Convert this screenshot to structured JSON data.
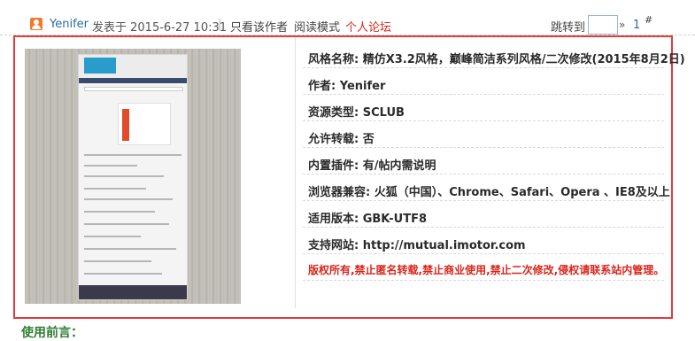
{
  "post_header": {
    "author": "Yenifer",
    "post_time": "发表于 2015-6-27 10:31",
    "separator": "|",
    "only_author": "只看该作者",
    "read_mode": "阅读模式",
    "personal_forum": "个人论坛",
    "jump_label": "跳转到",
    "jump_arrow": "»",
    "floor_number": "1",
    "floor_sign": "#"
  },
  "details": [
    {
      "label": "风格名称: 精仿X3.2风格，巅峰简洁系列风格/二次修改(2015年8月2日)"
    },
    {
      "label": "作者: Yenifer"
    },
    {
      "label": "资源类型: SCLUB"
    },
    {
      "label": "允许转载: 否"
    },
    {
      "label": "内置插件: 有/帖内需说明"
    },
    {
      "label": "浏览器兼容: 火狐（中国）、Chrome、Safari、Opera 、IE8及以上"
    },
    {
      "label": "适用版本: GBK-UTF8"
    },
    {
      "label": "支持网站: http://mutual.imotor.com"
    }
  ],
  "copyright_notice": "版权所有,禁止匿名转载,禁止商业使用,禁止二次修改,侵权请联系站内管理。",
  "usage_title": "使用前言：",
  "colors": {
    "link_blue": "#2b6ca3",
    "accent_red": "#d9261c",
    "frame_red": "#e23b3b",
    "heading_green": "#2f7d32"
  }
}
